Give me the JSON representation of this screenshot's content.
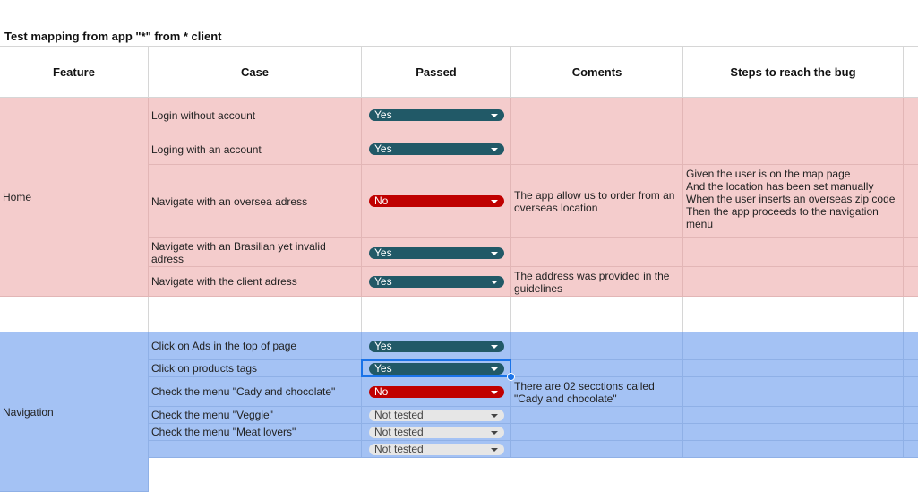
{
  "sheet": {
    "title": "Test mapping from app \"*\" from * client",
    "headers": [
      "Feature",
      "Case",
      "Passed",
      "Coments",
      "Steps to reach the bug"
    ],
    "groups": {
      "home": {
        "feature": "Home"
      },
      "navigation": {
        "feature": "Navigation"
      }
    },
    "rows": [
      {
        "case": "Login without account",
        "passed": "Yes",
        "comment": "",
        "steps": ""
      },
      {
        "case": "Loging with an account",
        "passed": "Yes",
        "comment": "",
        "steps": ""
      },
      {
        "case": "Navigate with an oversea adress",
        "passed": "No",
        "comment": "The app allow us to order from an overseas location",
        "steps": "Given the user is on the map page\nAnd the location has been set manually\nWhen the user inserts an overseas zip code\nThen the app proceeds to the navigation menu"
      },
      {
        "case": "Navigate with an Brasilian yet invalid adress",
        "passed": "Yes",
        "comment": "",
        "steps": ""
      },
      {
        "case": "Navigate with the client adress",
        "passed": "Yes",
        "comment": "The address was provided in the guidelines",
        "steps": ""
      },
      {
        "case": "Click on  Ads in the top of page",
        "passed": "Yes",
        "comment": "",
        "steps": ""
      },
      {
        "case": "Click on products tags",
        "passed": "Yes",
        "comment": "",
        "steps": ""
      },
      {
        "case": "Check the menu \"Cady and chocolate\"",
        "passed": "No",
        "comment": "There are 02 secctions called \"Cady and chocolate\"",
        "steps": ""
      },
      {
        "case": "Check the menu \"Veggie\"",
        "passed": "Not tested",
        "comment": "",
        "steps": ""
      },
      {
        "case": "Check the menu \"Meat lovers\"",
        "passed": "Not tested",
        "comment": "",
        "steps": ""
      },
      {
        "case": "",
        "passed": "Not tested",
        "comment": "",
        "steps": ""
      }
    ]
  },
  "colors": {
    "yes": "#215967",
    "no": "#c00000",
    "not_tested": "#e6e6e6",
    "home_fill": "#f4cccc",
    "nav_fill": "#a4c2f4",
    "selection": "#1a73e8"
  }
}
